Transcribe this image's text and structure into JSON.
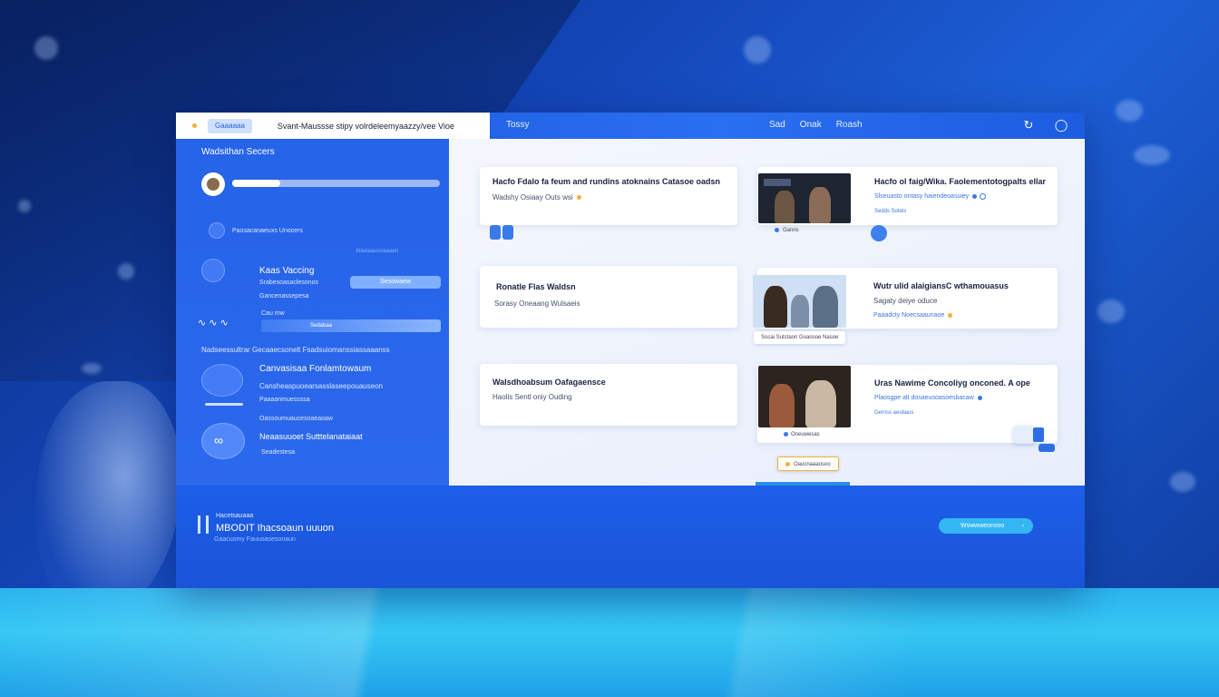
{
  "topbar": {
    "chip": "Gaaaaaa",
    "title": "Svant-Maussse stipy volrdeleemyaazzy/vee Vioe",
    "brand": "Tossy",
    "nav": [
      "Sad",
      "Onak",
      "Roash"
    ],
    "icons": [
      "refresh-icon",
      "user-icon"
    ]
  },
  "sidebar": {
    "heading": "Wadsithan Secers",
    "progress": 0.23,
    "item1": {
      "text": "Paosacanaeuxs Unocers"
    },
    "caption": "Atasiaaussiaaaen",
    "item2": {
      "title": "Kaas Vaccing",
      "line1": "Srabesoasaclesonos",
      "line2": "Gancenassepesa",
      "button": "Sesowaew",
      "small": "Cau mw",
      "track": "Sedabaa"
    },
    "section": "Nadseessultrar Gecaaecsonelt Fsadsuiomanssiassaaanss",
    "item3": {
      "title": "Canvasisaa Fonlamtowaum",
      "line1": "Cansheaspuoearsasslaseepouauseon",
      "line2": "Paaaanmuessssa"
    },
    "item4": {
      "line0": "Oassoumuaucesoaeaoaw",
      "title": "Neaasuuoet Sutttelanataiaat",
      "line1": "Seadestesa"
    }
  },
  "cards": {
    "left": [
      {
        "title": "Hacfo Fdalo fa feum and rundins atoknains Catasoe oadsn",
        "sub": "Wadshy Osiaay Outs wsi"
      },
      {
        "title": "Ronatle Flas Waldsn",
        "sub": "Sorasy Oneaang Wulsaeis"
      },
      {
        "title": "Walsdhoabsum Oafagaensce",
        "sub": "Haolis Sentl oniy Ouding"
      }
    ],
    "right": [
      {
        "title": "Hacfo ol faig/Wika. Faolementotogpalts ellar",
        "meta1": "Slseuasto ontasy haiendeoasuiey",
        "meta2": "Sedds Sotels",
        "caption": "Ganns"
      },
      {
        "title": "Wutr ulid alaigiansC wthamouasus",
        "sub": "Sagaty deiye oduce",
        "meta1": "Paaadcty Noecsaaunaoe",
        "caption": "Socai Sutstaon Goaosoe Nasoe"
      },
      {
        "title": "Uras Nawime Concoliyg onconed. A ope",
        "meta1": "Plaosgpe alt dosaeusoasoesbacaw",
        "meta2": "Gemss aeutiaus",
        "caption": "Oneuwesas",
        "tag": "Oaucnaaaosoo"
      }
    ]
  },
  "footer": {
    "small": "Hacetsauaaa",
    "title": "MBODIT Ihacsoaun uuuon",
    "sub": "Gaacuomy Fauuoasesonaun",
    "button": "Wswwweonsoo"
  },
  "colors": {
    "accent": "#1f5fe0",
    "sky": "#33b6f2",
    "card": "#ffffff",
    "amber": "#f2b233"
  }
}
